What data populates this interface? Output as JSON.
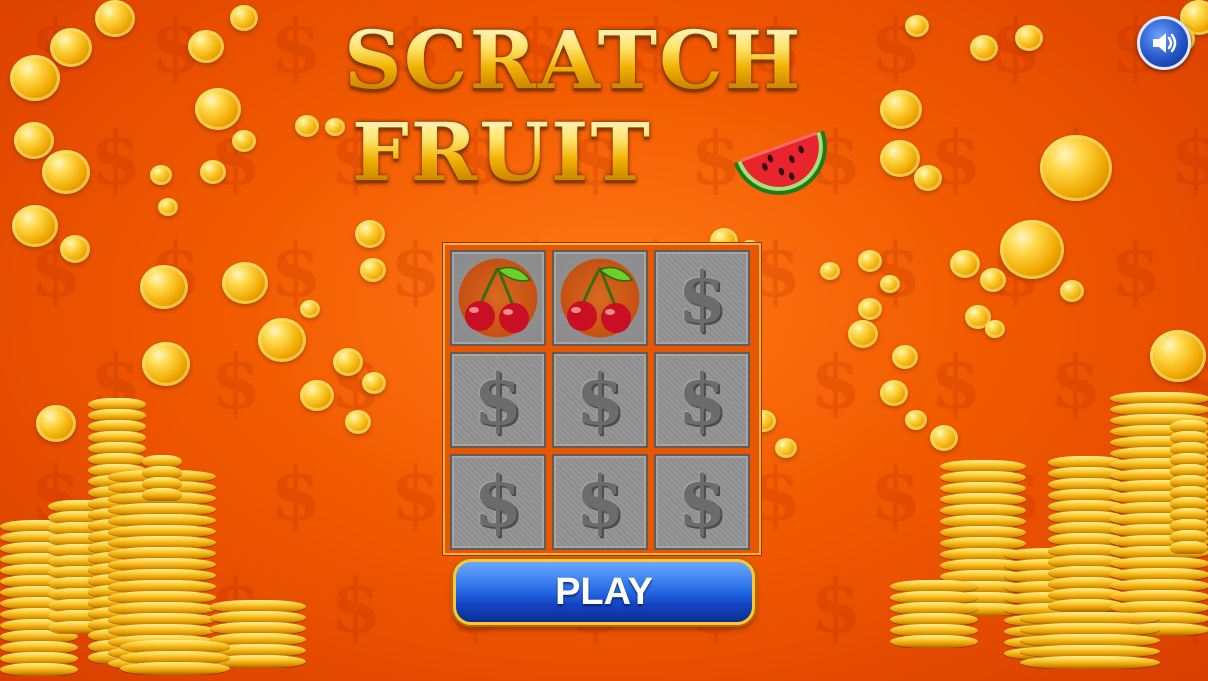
{
  "game": {
    "title_line1": "SCRATCH",
    "title_line2": "FRUIT",
    "logo_fruit": "watermelon-icon"
  },
  "controls": {
    "sound_icon": "speaker-icon",
    "play_label": "PLAY"
  },
  "board": {
    "rows": 3,
    "cols": 3,
    "cells": [
      {
        "state": "revealed",
        "symbol": "cherry-icon"
      },
      {
        "state": "revealed",
        "symbol": "cherry-icon"
      },
      {
        "state": "partial",
        "symbol": "dollar-icon"
      },
      {
        "state": "covered",
        "symbol": "dollar-icon"
      },
      {
        "state": "covered",
        "symbol": "dollar-icon"
      },
      {
        "state": "covered",
        "symbol": "dollar-icon"
      },
      {
        "state": "covered",
        "symbol": "dollar-icon"
      },
      {
        "state": "covered",
        "symbol": "dollar-icon"
      },
      {
        "state": "covered",
        "symbol": "dollar-icon"
      }
    ],
    "cover_glyph": "$"
  },
  "colors": {
    "background": "#f25a00",
    "gold": "#ffd84a",
    "play_button": "#2a6fe8"
  }
}
